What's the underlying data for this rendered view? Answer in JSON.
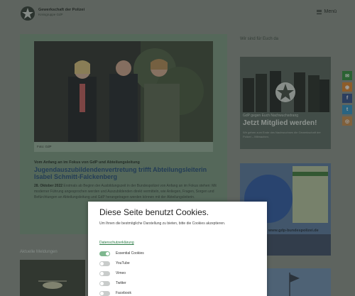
{
  "header": {
    "brand_title": "Gewerkschaft der Polizei",
    "brand_sub": "Kreisgruppe GdP",
    "menu_label": "Menü"
  },
  "feature": {
    "photo_caption": "Foto: GdP",
    "kicker": "Vom Anfang an im Fokus von GdP und Abteilungsleitung",
    "headline": "Jugendauszubildendenvertretung trifft Abteilungsleiterin Isabel Schmitt-Falckenberg",
    "teaser_date": "28. Oktober 2022",
    "teaser_text": " Erstmals ab Beginn der Ausbildungszeit in der Bundespolizei von Anfang an im Fokus stehen: Mit moderner Führung angesprochen werden und Auszubildenden direkt vermitteln, wie Anliegen, Fragen, Sorgen und Befürchtungen an Abteilungsleitung und GdP herangetragen werden können mit der Abteilungsleiterin."
  },
  "sidebar": {
    "heading": "Wir sind für Euch da",
    "promo_small": "GdP gegen Euch Nachwuchsdrang",
    "promo_big": "Jetzt Mitglied werden!",
    "promo_lines": "Wir gehen zum Ende des Nachwuchses die Gewerkschaft der Polizei – Mitmachen.",
    "ad_url": "www.gdp-bundespolizei.de"
  },
  "latest": {
    "heading": "Aktuelle Meldungen"
  },
  "social": {
    "mail": "✉",
    "rss": "◉",
    "facebook": "f",
    "twitter": "t",
    "instagram": "◎"
  },
  "cookie": {
    "title": "Diese Seite benutzt Cookies.",
    "text": "Um Ihnen die bestmögliche Darstellung zu bieten, bitte die Cookies akzeptieren.",
    "privacy_link": "Datenschutzerklärung",
    "options": [
      {
        "label": "Essential Cookies",
        "on": true
      },
      {
        "label": "YouTube",
        "on": false
      },
      {
        "label": "Vimeo",
        "on": false
      },
      {
        "label": "Twitter",
        "on": false
      },
      {
        "label": "Facebook",
        "on": false
      }
    ]
  },
  "colors": {
    "accent_green": "#7a9a82",
    "headline_blue": "#1f4a7a",
    "toggle_on": "#7fb88f"
  }
}
